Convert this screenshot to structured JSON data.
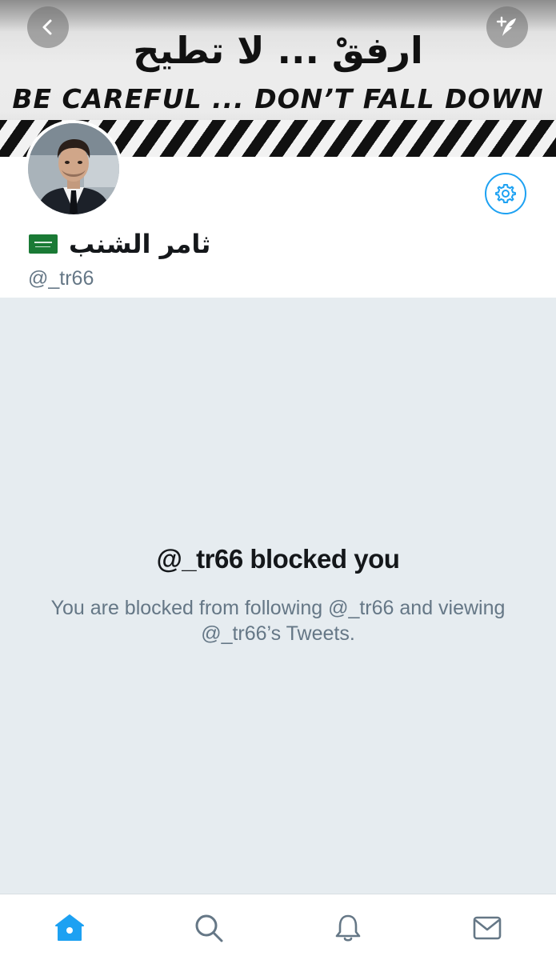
{
  "header": {
    "banner_text_arabic": "ارفقْ ... لا تطيح",
    "banner_text_english": "BE CAREFUL ... DON’T FALL DOWN",
    "back_icon": "chevron-left-icon",
    "compose_icon": "compose-tweet-icon"
  },
  "profile": {
    "display_name": "ثامر الشنب",
    "flag_emoji": "saudi-arabia-flag-icon",
    "handle": "@_tr66",
    "settings_icon": "gear-icon"
  },
  "blocked": {
    "title": "@_tr66 blocked you",
    "description": "You are blocked from following @_tr66 and viewing @_tr66’s Tweets."
  },
  "tabbar": {
    "items": [
      {
        "icon": "home-icon",
        "active": true
      },
      {
        "icon": "search-icon",
        "active": false
      },
      {
        "icon": "bell-icon",
        "active": false
      },
      {
        "icon": "mail-icon",
        "active": false
      }
    ]
  },
  "colors": {
    "accent": "#1da1f2",
    "background": "#e6ecf0",
    "text_primary": "#14171a",
    "text_secondary": "#657786",
    "icon_inactive": "#657786"
  }
}
